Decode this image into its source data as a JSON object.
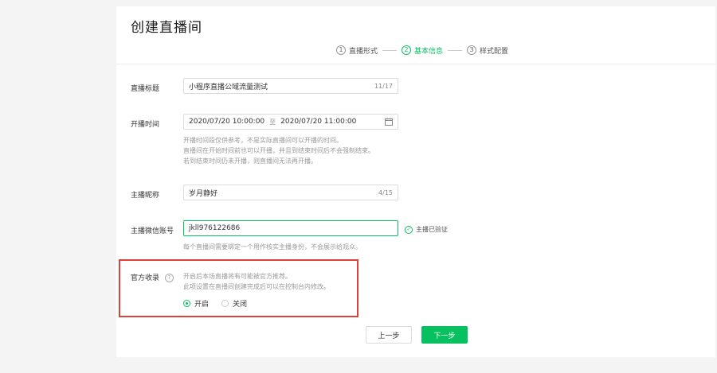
{
  "page": {
    "title": "创建直播间"
  },
  "steps": [
    {
      "num": "1",
      "label": "直播形式",
      "active": false
    },
    {
      "num": "2",
      "label": "基本信息",
      "active": true
    },
    {
      "num": "3",
      "label": "样式配置",
      "active": false
    }
  ],
  "form": {
    "title_label": "直播标题",
    "title_value": "小程序直播公域流量测试",
    "title_count": "11/17",
    "time_label": "开播时间",
    "time_start": "2020/07/20 10:00:00",
    "time_sep": "至",
    "time_end": "2020/07/20 11:00:00",
    "time_hints": [
      "开播时间段仅供参考，不是实际直播间可以开播的时间。",
      "直播间在开始时间前也可以开播，并且到结束时间后不会强制结束。",
      "若到结束时间仍未开播，则直播间无法再开播。"
    ],
    "anchor_label": "主播昵称",
    "anchor_value": "岁月静好",
    "anchor_count": "4/15",
    "wechat_label": "主播微信账号",
    "wechat_value": "jkll976122686",
    "wechat_verified": "主播已验证",
    "wechat_hint": "每个直播间需要绑定一个用作核实主播身份，不会展示给观众。",
    "official_label": "官方收录",
    "official_hints": [
      "开启后本场直播将有可能被官方推荐。",
      "此项设置在直播间创建完成后可以在控制台内修改。"
    ],
    "official_options": [
      "开启",
      "关闭"
    ],
    "official_selected": "开启"
  },
  "buttons": {
    "prev": "上一步",
    "next": "下一步"
  },
  "colors": {
    "accent": "#07c160",
    "highlight_border": "#e0403a"
  }
}
